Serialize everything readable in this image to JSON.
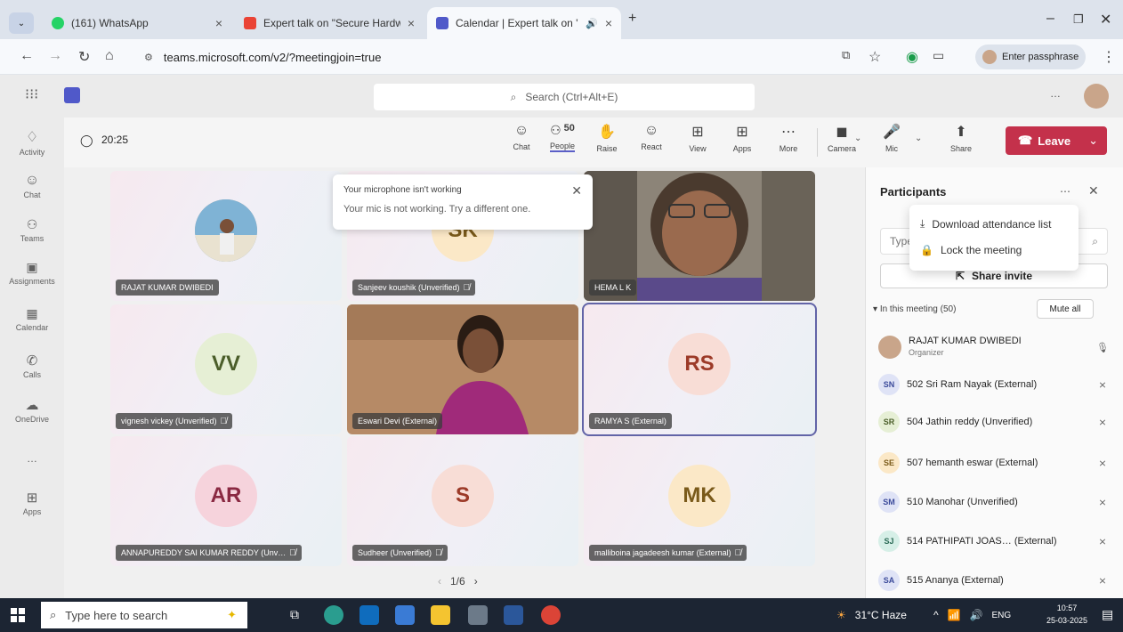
{
  "browser": {
    "tabs": [
      {
        "title": "(161) WhatsApp",
        "active": false
      },
      {
        "title": "Expert talk on \"Secure Hardwa…",
        "active": false
      },
      {
        "title": "Calendar | Expert talk on \"S…",
        "active": true
      }
    ],
    "url": "teams.microsoft.com/v2/?meetingjoin=true",
    "passphrase_label": "Enter passphrase"
  },
  "teams_header": {
    "search_placeholder": "Search (Ctrl+Alt+E)",
    "more": "…"
  },
  "rail": [
    {
      "label": "Activity",
      "icon": "bell-icon"
    },
    {
      "label": "Chat",
      "icon": "chat-icon"
    },
    {
      "label": "Teams",
      "icon": "teams-icon"
    },
    {
      "label": "Assignments",
      "icon": "assignments-icon"
    },
    {
      "label": "Calendar",
      "icon": "calendar-icon"
    },
    {
      "label": "Calls",
      "icon": "phone-icon"
    },
    {
      "label": "OneDrive",
      "icon": "cloud-icon"
    },
    {
      "label": "…",
      "icon": "more-icon"
    },
    {
      "label": "Apps",
      "icon": "apps-icon"
    }
  ],
  "meeting_toolbar": {
    "timer": "20:25",
    "people_count": "50",
    "buttons": [
      {
        "label": "Chat",
        "icon": "chat-icon"
      },
      {
        "label": "People",
        "icon": "people-icon"
      },
      {
        "label": "Raise",
        "icon": "raise-hand-icon"
      },
      {
        "label": "React",
        "icon": "smile-icon"
      },
      {
        "label": "View",
        "icon": "view-grid-icon"
      },
      {
        "label": "Apps",
        "icon": "apps-icon"
      },
      {
        "label": "More",
        "icon": "more-icon"
      }
    ],
    "devices": [
      {
        "label": "Camera",
        "icon": "camera-off-icon"
      },
      {
        "label": "Mic",
        "icon": "mic-icon"
      },
      {
        "label": "Share",
        "icon": "share-icon"
      }
    ],
    "leave_label": "Leave"
  },
  "tiles": [
    {
      "name": "RAJAT KUMAR DWIBEDI",
      "initials": "",
      "type": "photo",
      "muted": false,
      "bg": "#f4ebe3"
    },
    {
      "name": "Sanjeev koushik (Unverified)",
      "initials": "SK",
      "type": "initials",
      "muted": true,
      "bg": "#fbe8c7",
      "fg": "#7a5a1a"
    },
    {
      "name": "HEMA L K",
      "initials": "",
      "type": "video",
      "muted": false,
      "bg": "#7a6a5a"
    },
    {
      "name": "vignesh vickey (Unverified)",
      "initials": "VV",
      "type": "initials",
      "muted": true,
      "bg": "#e6efd5",
      "fg": "#4b5e2a"
    },
    {
      "name": "Eswari Devi (External)",
      "initials": "",
      "type": "video2",
      "muted": false,
      "bg": "#b08a6a"
    },
    {
      "name": "RAMYA S (External)",
      "initials": "RS",
      "type": "initials",
      "muted": false,
      "bg": "#f8ddd6",
      "fg": "#9c3a28",
      "selected": true
    },
    {
      "name": "ANNAPUREDDY SAI KUMAR REDDY (Unv…",
      "initials": "AR",
      "type": "initials",
      "muted": true,
      "bg": "#f6d3dc",
      "fg": "#8a2942"
    },
    {
      "name": "Sudheer (Unverified)",
      "initials": "S",
      "type": "initials",
      "muted": true,
      "bg": "#f8ddd6",
      "fg": "#9c3a28"
    },
    {
      "name": "malliboina jagadeesh kumar (External)",
      "initials": "MK",
      "type": "initials",
      "muted": true,
      "bg": "#fbe8c7",
      "fg": "#7a5a1a"
    }
  ],
  "pager": "1/6",
  "toast": {
    "title": "Your microphone isn't working",
    "body": "Your mic is not working. Try a different one."
  },
  "participants": {
    "title": "Participants",
    "search_placeholder": "Type",
    "share_invite": "Share invite",
    "section": "In this meeting (50)",
    "mute_all": "Mute all",
    "menu": [
      "Download attendance list",
      "Lock the meeting"
    ],
    "list": [
      {
        "initials": "",
        "name": "RAJAT KUMAR DWIBEDI",
        "sub": "Organizer",
        "bg": "#c9a58a",
        "fg": "#fff",
        "mic": "on"
      },
      {
        "initials": "SN",
        "name": "502 Sri Ram Nayak (External)",
        "sub": "",
        "bg": "#dfe3f6",
        "fg": "#3b4a9a",
        "mic": "off"
      },
      {
        "initials": "SR",
        "name": "504 Jathin reddy (Unverified)",
        "sub": "",
        "bg": "#e6efd5",
        "fg": "#4b5e2a",
        "mic": "off"
      },
      {
        "initials": "SE",
        "name": "507 hemanth eswar (External)",
        "sub": "",
        "bg": "#fbe8c7",
        "fg": "#7a5a1a",
        "mic": "off"
      },
      {
        "initials": "SM",
        "name": "510 Manohar (Unverified)",
        "sub": "",
        "bg": "#dfe3f6",
        "fg": "#3b4a9a",
        "mic": "off"
      },
      {
        "initials": "SJ",
        "name": "514 PATHIPATI JOAS… (External)",
        "sub": "",
        "bg": "#d6efe7",
        "fg": "#2a6a55",
        "mic": "off"
      },
      {
        "initials": "SA",
        "name": "515 Ananya (External)",
        "sub": "",
        "bg": "#dfe3f6",
        "fg": "#3b4a9a",
        "mic": "off"
      }
    ]
  },
  "taskbar": {
    "search_placeholder": "Type here to search",
    "weather": "31°C Haze",
    "lang": "ENG",
    "time": "10:57",
    "date": "25-03-2025"
  }
}
